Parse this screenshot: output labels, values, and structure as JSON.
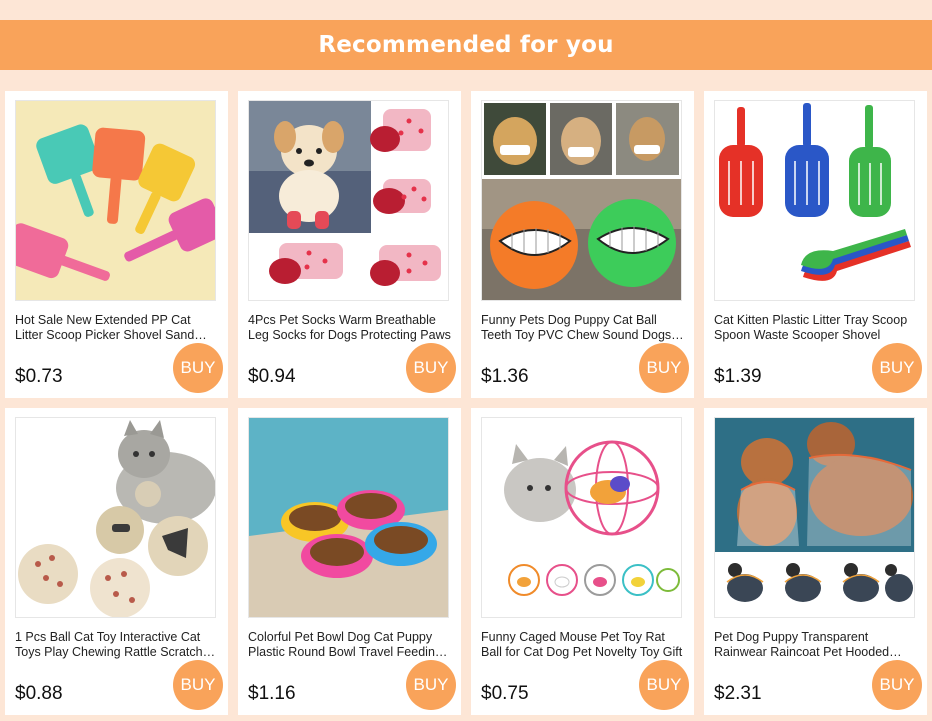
{
  "header": {
    "title": "Recommended for you"
  },
  "colors": {
    "background": "#fde6d6",
    "accent": "#f9a35a",
    "card": "#ffffff"
  },
  "products": [
    {
      "title": "Hot Sale New Extended PP Cat Litter Scoop Picker Shovel Sand Cleaning Tool",
      "price": "$0.73",
      "buy_label": "BUY",
      "image": "litter-scoops-image"
    },
    {
      "title": "4Pcs Pet Socks Warm Breathable Leg Socks for Dogs Protecting Paws",
      "price": "$0.94",
      "buy_label": "BUY",
      "image": "dog-socks-image"
    },
    {
      "title": "Funny Pets Dog Puppy Cat Ball Teeth Toy PVC Chew Sound Dogs Play",
      "price": "$1.36",
      "buy_label": "BUY",
      "image": "teeth-ball-image"
    },
    {
      "title": "Cat Kitten Plastic Litter Tray Scoop Spoon Waste Scooper Shovel",
      "price": "$1.39",
      "buy_label": "BUY",
      "image": "litter-scoop-spoons-image"
    },
    {
      "title": "1 Pcs Ball Cat Toy Interactive Cat Toys Play Chewing Rattle Scratch Catch",
      "price": "$0.88",
      "buy_label": "BUY",
      "image": "cat-balls-image"
    },
    {
      "title": "Colorful Pet Bowl Dog Cat Puppy Plastic Round Bowl Travel Feeding Water",
      "price": "$1.16",
      "buy_label": "BUY",
      "image": "pet-bowls-image"
    },
    {
      "title": "Funny Caged Mouse Pet Toy Rat Ball for Cat Dog Pet Novelty Toy Gift",
      "price": "$0.75",
      "buy_label": "BUY",
      "image": "caged-mouse-image"
    },
    {
      "title": "Pet Dog Puppy Transparent Rainwear Raincoat Pet Hooded Waterproof Jacket",
      "price": "$2.31",
      "buy_label": "BUY",
      "image": "dog-raincoat-image"
    }
  ]
}
